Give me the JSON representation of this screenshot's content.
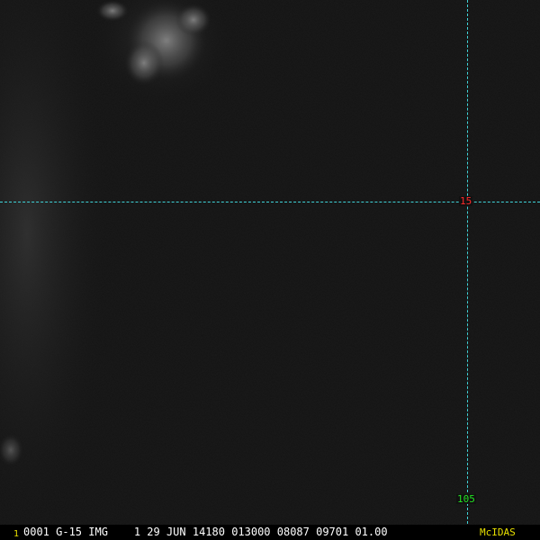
{
  "image": {
    "satellite": "G-15",
    "product": "IMG"
  },
  "gridlines": {
    "latitude_label": "15",
    "longitude_label": "105"
  },
  "info_bar": {
    "frame_number": "1",
    "text": "0001 G-15 IMG    1 29 JUN 14180 013000 08087 09701 01.00",
    "brand": "McIDAS"
  },
  "colors": {
    "background": "#111111",
    "grid_line": "#3fd3d8",
    "latitude_label": "#ff2a2a",
    "longitude_label": "#22e022",
    "info_text": "#ffffff",
    "frame_number": "#e8e000",
    "brand": "#e8e000"
  }
}
